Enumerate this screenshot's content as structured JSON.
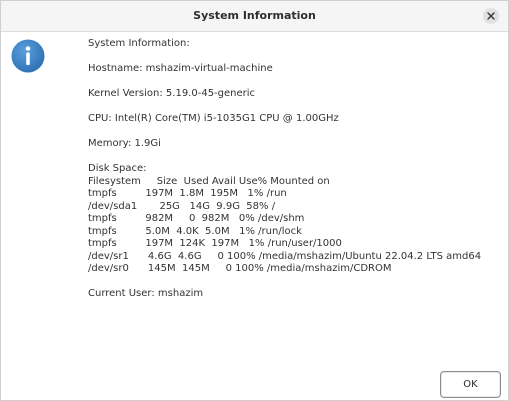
{
  "window": {
    "title": "System Information",
    "close_icon": "close-icon",
    "info_icon": "info-icon"
  },
  "content": {
    "heading": "System Information:",
    "hostname": "Hostname: mshazim-virtual-machine",
    "kernel": "Kernel Version: 5.19.0-45-generic",
    "cpu": "CPU: Intel(R) Core(TM) i5-1035G1 CPU @ 1.00GHz",
    "memory": "Memory: 1.9Gi",
    "disk_heading": "Disk Space:",
    "disk_rows": [
      "Filesystem     Size  Used Avail Use% Mounted on",
      "tmpfs         197M  1.8M  195M   1% /run",
      "/dev/sda1       25G   14G  9.9G  58% /",
      "tmpfs         982M     0  982M   0% /dev/shm",
      "tmpfs         5.0M  4.0K  5.0M   1% /run/lock",
      "tmpfs         197M  124K  197M   1% /run/user/1000",
      "/dev/sr1      4.6G  4.6G     0 100% /media/mshazim/Ubuntu 22.04.2 LTS amd64",
      "/dev/sr0      145M  145M     0 100% /media/mshazim/CDROM"
    ],
    "current_user": "Current User: mshazim"
  },
  "buttons": {
    "ok_label": "OK"
  },
  "colors": {
    "info_icon_bg": "#3b82c4",
    "titlebar_bg": "#f5f5f5"
  }
}
